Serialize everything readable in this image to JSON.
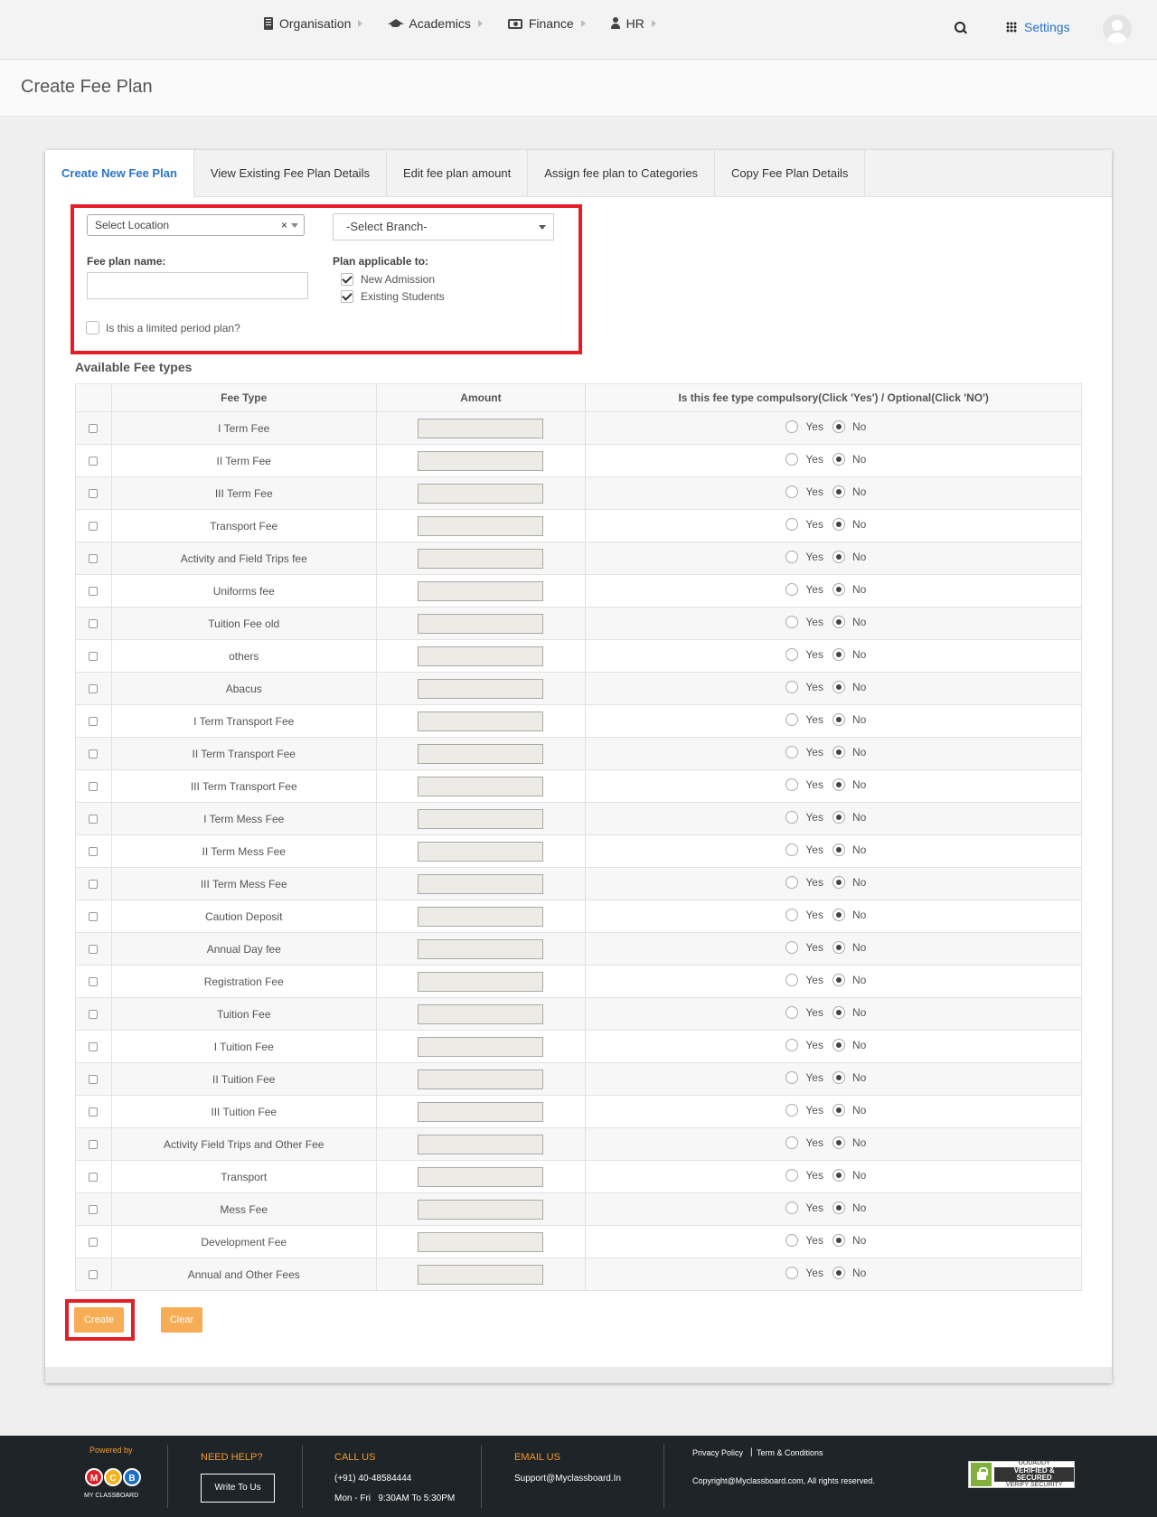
{
  "nav": {
    "items": [
      {
        "label": "Organisation",
        "icon": "building-icon"
      },
      {
        "label": "Academics",
        "icon": "graduation-cap-icon"
      },
      {
        "label": "Finance",
        "icon": "money-icon"
      },
      {
        "label": "HR",
        "icon": "user-icon"
      }
    ],
    "settings_label": "Settings"
  },
  "page": {
    "title": "Create Fee Plan"
  },
  "tabs": [
    {
      "label": "Create New Fee Plan",
      "active": true
    },
    {
      "label": "View Existing Fee Plan Details",
      "active": false
    },
    {
      "label": "Edit fee plan amount",
      "active": false
    },
    {
      "label": "Assign fee plan to Categories",
      "active": false
    },
    {
      "label": "Copy Fee Plan Details",
      "active": false
    }
  ],
  "form": {
    "location_select": "Select Location",
    "location_clear": "×",
    "branch_select": "-Select Branch-",
    "fee_plan_name_label": "Fee plan name:",
    "fee_plan_name_value": "",
    "applicable_label": "Plan applicable to:",
    "new_admission": "New Admission",
    "existing_students": "Existing Students",
    "limited_period": "Is this a limited period plan?"
  },
  "fee_section": {
    "title": "Available Fee types",
    "headers": [
      "",
      "Fee Type",
      "Amount",
      "Is this fee type compulsory(Click 'Yes') / Optional(Click 'NO')"
    ],
    "yes_label": "Yes",
    "no_label": "No",
    "rows": [
      "I Term Fee",
      "II Term Fee",
      "III Term Fee",
      "Transport Fee",
      "Activity and Field Trips fee",
      "Uniforms fee",
      "Tuition Fee old",
      "others",
      "Abacus",
      "I Term Transport Fee",
      "II Term Transport Fee",
      "III Term Transport Fee",
      "I Term Mess Fee",
      "II Term Mess Fee",
      "III Term Mess Fee",
      "Caution Deposit",
      "Annual Day fee",
      "Registration Fee",
      "Tuition Fee",
      "I Tuition Fee",
      "II Tuition Fee",
      "III Tuition Fee",
      "Activity Field Trips and Other Fee",
      "Transport",
      "Mess Fee",
      "Development Fee",
      "Annual and Other Fees"
    ]
  },
  "buttons": {
    "create": "Create",
    "clear": "Clear"
  },
  "footer": {
    "powered_by": "Powered by",
    "brand_letters": [
      "M",
      "C",
      "B"
    ],
    "brand_name": "MY CLASSBOARD",
    "need_help": "NEED HELP?",
    "write_to_us": "Write To Us",
    "call_us": "CALL US",
    "phone": "(+91) 40-48584444",
    "hours": "Mon - Fri   9:30AM To 5:30PM",
    "email_us": "EMAIL US",
    "email": "Support@Myclassboard.In",
    "privacy": "Privacy Policy",
    "terms": "Term & Conditions",
    "link_separator": "|",
    "copyright": "Copyright@Myclassboard.com, All rights reserved.",
    "seal_top": "GODADDY",
    "seal_mid": "VERIFIED & SECURED",
    "seal_bot": "VERIFY SECURITY"
  },
  "colors": {
    "accent": "#2a73c6",
    "button": "#f6ad55",
    "highlight": "#e31e26",
    "footer_bg": "#1f2428",
    "footer_accent": "#f29a2e"
  }
}
